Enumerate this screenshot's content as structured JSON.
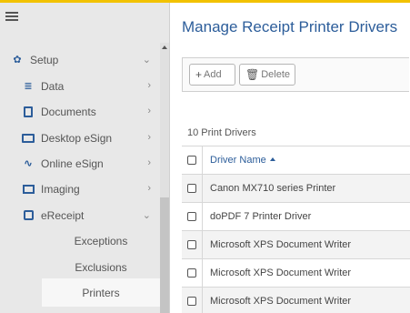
{
  "sidebar": {
    "menu_icon": "hamburger-icon",
    "items": [
      {
        "label": "Setup",
        "icon": "gear-icon",
        "chevron": "⌄"
      },
      {
        "label": "Data",
        "icon": "database-icon",
        "chevron": "›"
      },
      {
        "label": "Documents",
        "icon": "document-icon",
        "chevron": "›"
      },
      {
        "label": "Desktop eSign",
        "icon": "monitor-icon",
        "chevron": "›"
      },
      {
        "label": "Online eSign",
        "icon": "signature-icon",
        "chevron": "›"
      },
      {
        "label": "Imaging",
        "icon": "image-icon",
        "chevron": "›"
      },
      {
        "label": "eReceipt",
        "icon": "receipt-icon",
        "chevron": "⌄"
      }
    ],
    "subitems": [
      {
        "label": "Exceptions"
      },
      {
        "label": "Exclusions"
      },
      {
        "label": "Printers",
        "active": true
      }
    ]
  },
  "main": {
    "title": "Manage Receipt Printer Drivers",
    "toolbar": {
      "add_label": "Add",
      "delete_label": "Delete"
    },
    "count_label": "10 Print Drivers",
    "table": {
      "header": "Driver Name",
      "sort": "ascending",
      "rows": [
        "Canon MX710 series Printer",
        "doPDF 7 Printer Driver",
        "Microsoft XPS Document Writer",
        "Microsoft XPS Document Writer",
        "Microsoft XPS Document Writer"
      ]
    }
  },
  "colors": {
    "accent": "#2c5d9a",
    "topbar": "#f2c200",
    "sidebar_bg": "#e8e8e8"
  }
}
